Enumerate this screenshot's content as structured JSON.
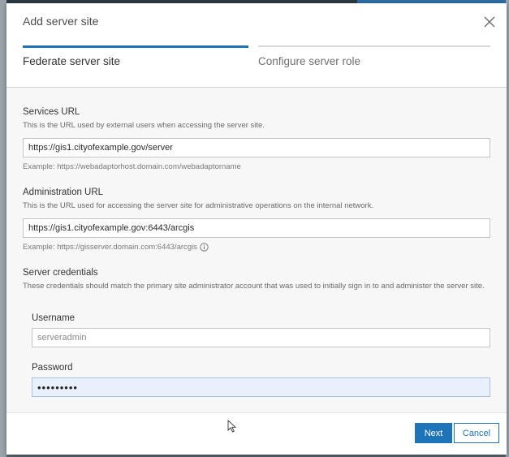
{
  "dialog": {
    "title": "Add server site",
    "close_icon": "close-icon"
  },
  "steps": [
    {
      "label": "Federate server site",
      "active": true
    },
    {
      "label": "Configure server role",
      "active": false
    }
  ],
  "services_url": {
    "label": "Services URL",
    "description": "This is the URL used by external users when accessing the server site.",
    "value": "https://gis1.cityofexample.gov/server",
    "example": "Example: https://webadaptorhost.domain.com/webadaptorname"
  },
  "admin_url": {
    "label": "Administration URL",
    "description": "This is the URL used for accessing the server site for administrative operations on the internal network.",
    "value": "https://gis1.cityofexample.gov:6443/arcgis",
    "example": "Example: https://gisserver.domain.com:6443/arcgis",
    "example_icon": "info-icon"
  },
  "credentials": {
    "label": "Server credentials",
    "description": "These credentials should match the primary site administrator account that was used to initially sign in to and administer the server site.",
    "username_label": "Username",
    "username_value": "serveradmin",
    "password_label": "Password",
    "password_value": "•••••••••"
  },
  "footer": {
    "next_label": "Next",
    "cancel_label": "Cancel"
  },
  "colors": {
    "accent": "#1e74b8",
    "focused_field": "#e8f0fb"
  }
}
